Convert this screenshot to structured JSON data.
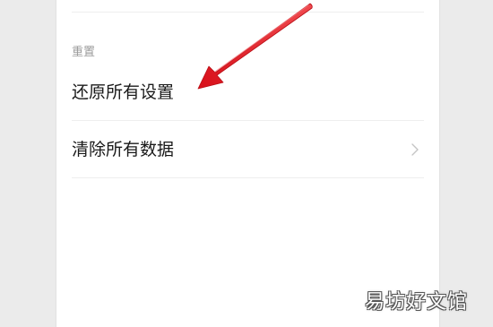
{
  "settings": {
    "section_header": "重置",
    "items": [
      {
        "label": "还原所有设置",
        "has_chevron": false
      },
      {
        "label": "清除所有数据",
        "has_chevron": true
      }
    ]
  },
  "annotation": {
    "arrow_color": "#e0141e"
  },
  "watermark": {
    "text": "易坊好文馆"
  }
}
